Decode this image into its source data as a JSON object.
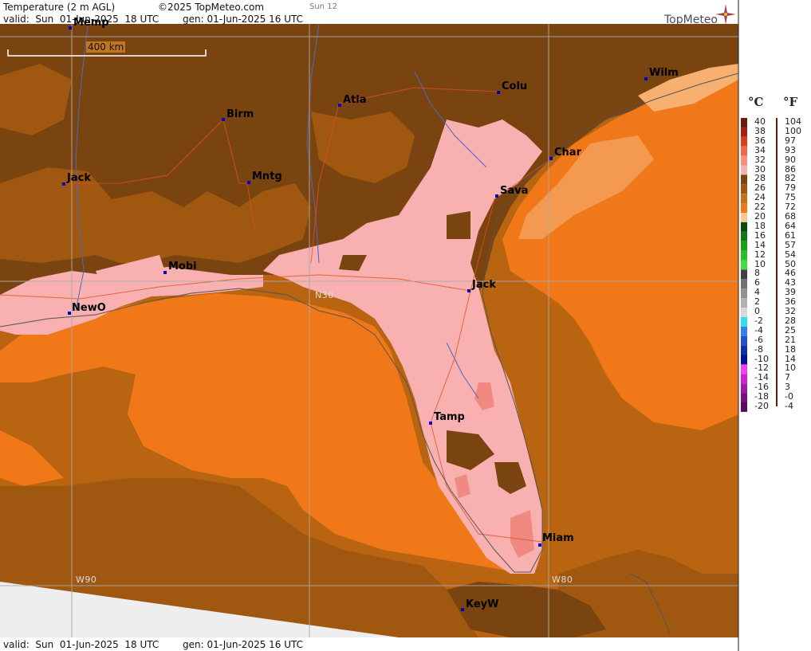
{
  "header": {
    "title": "Temperature (2 m AGL)",
    "copyright": "©2025 TopMeteo.com",
    "valid": "valid:  Sun  01-Jun-2025  18 UTC",
    "gen": "gen: 01-Jun-2025 16 UTC",
    "run_label": "Sun 12",
    "logo": "TopMeteo"
  },
  "footer": {
    "valid": "valid:  Sun  01-Jun-2025  18 UTC",
    "gen": "gen: 01-Jun-2025 16 UTC"
  },
  "scale_bar": {
    "label": "400 km"
  },
  "gridlines": [
    {
      "label": "N30"
    },
    {
      "label": "W90"
    },
    {
      "label": "W80"
    }
  ],
  "cities": [
    {
      "name": "Memp"
    },
    {
      "name": "Birm"
    },
    {
      "name": "Atla"
    },
    {
      "name": "Colu"
    },
    {
      "name": "Wilm"
    },
    {
      "name": "Char"
    },
    {
      "name": "Jack"
    },
    {
      "name": "Mntg"
    },
    {
      "name": "Sava"
    },
    {
      "name": "Mobi"
    },
    {
      "name": "Jack"
    },
    {
      "name": "NewO"
    },
    {
      "name": "Tamp"
    },
    {
      "name": "Miam"
    },
    {
      "name": "KeyW"
    }
  ],
  "legend": {
    "unit_c": "°C",
    "unit_f": "°F",
    "celsius": [
      "40",
      "38",
      "36",
      "34",
      "32",
      "30",
      "28",
      "26",
      "24",
      "22",
      "20",
      "18",
      "16",
      "14",
      "12",
      "10",
      "8",
      "6",
      "4",
      "2",
      "0",
      "-2",
      "-4",
      "-6",
      "-8",
      "-10",
      "-12",
      "-14",
      "-16",
      "-18",
      "-20"
    ],
    "fahrenheit": [
      "104",
      "100",
      "97",
      "93",
      "90",
      "86",
      "82",
      "79",
      "75",
      "72",
      "68",
      "64",
      "61",
      "57",
      "54",
      "50",
      "46",
      "43",
      "39",
      "36",
      "32",
      "28",
      "25",
      "21",
      "18",
      "14",
      "10",
      "7",
      "3",
      "-0",
      "-4"
    ],
    "colors": [
      "#6b1a10",
      "#a82010",
      "#d8401a",
      "#f06848",
      "#f89080",
      "#f8b0b0",
      "#7a4410",
      "#a05810",
      "#c87014",
      "#f07818",
      "#f8c890",
      "#0a4a10",
      "#107a10",
      "#18a018",
      "#28c028",
      "#40e040",
      "#404040",
      "#707070",
      "#909090",
      "#b0b0b0",
      "#d8d8d8",
      "#30e0e8",
      "#3080f0",
      "#2050d0",
      "#1030a8",
      "#0010a0",
      "#f040f0",
      "#d020d0",
      "#a018a8",
      "#781080",
      "#5a0a60"
    ]
  }
}
